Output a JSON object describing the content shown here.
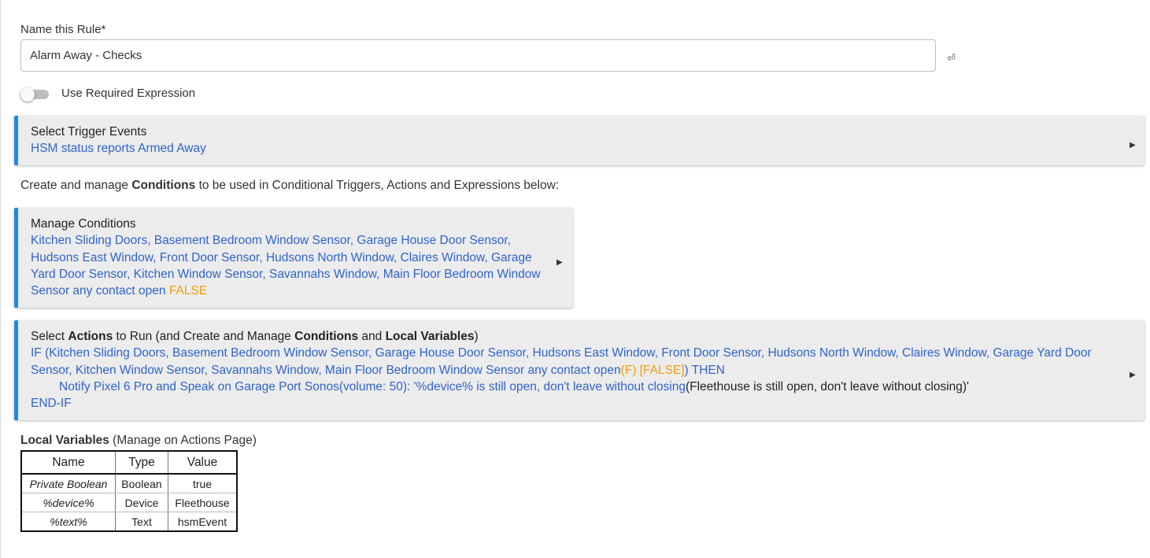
{
  "rule_name": {
    "label": "Name this Rule*",
    "value": "Alarm Away - Checks",
    "enter_glyph": "⏎"
  },
  "required_expression": {
    "label": "Use Required Expression",
    "enabled": false
  },
  "trigger": {
    "title": "Select Trigger Events",
    "summary": "HSM status reports Armed Away"
  },
  "conditions_info": {
    "before": "Create and manage ",
    "bold": "Conditions",
    "after": " to be used in Conditional Triggers, Actions and Expressions below:"
  },
  "conditions": {
    "title": "Manage Conditions",
    "summary": "Kitchen Sliding Doors, Basement Bedroom Window Sensor, Garage House Door Sensor, Hudsons East Window, Front Door Sensor, Hudsons North Window, Claires Window, Garage Yard Door Sensor, Kitchen Window Sensor, Savannahs Window, Main Floor Bedroom Window Sensor any contact open ",
    "state": "FALSE"
  },
  "actions": {
    "title_1": "Select ",
    "title_b1": "Actions",
    "title_2": " to Run (and Create and Manage ",
    "title_b2": "Conditions",
    "title_3": " and ",
    "title_b3": "Local Variables",
    "title_4": ")",
    "if_text": "IF (Kitchen Sliding Doors, Basement Bedroom Window Sensor, Garage House Door Sensor, Hudsons East Window, Front Door Sensor, Hudsons North Window, Claires Window, Garage Yard Door Sensor, Kitchen Window Sensor, Savannahs Window, Main Floor Bedroom Window Sensor any contact open",
    "if_state": "(F) [FALSE]",
    "then_text": ") THEN",
    "notify_text": "Notify Pixel 6 Pro and Speak on Garage Port Sonos(volume: 50): '%device% is still open, don't leave without closing",
    "notify_preview": "(Fleethouse is still open, don't leave without closing)'",
    "end_text": "END-IF"
  },
  "local_variables": {
    "title": "Local Variables",
    "note": " (Manage on Actions Page)",
    "headers": [
      "Name",
      "Type",
      "Value"
    ],
    "rows": [
      [
        "Private Boolean",
        "Boolean",
        "true"
      ],
      [
        "%device%",
        "Device",
        "Fleethouse"
      ],
      [
        "%text%",
        "Text",
        "hsmEvent"
      ]
    ]
  },
  "icons": {
    "expand": "▶"
  },
  "colors": {
    "accent": "#1e88e5",
    "link_blue": "#3064c8",
    "state_orange": "#f29e0c",
    "card_bg": "#ececec"
  }
}
